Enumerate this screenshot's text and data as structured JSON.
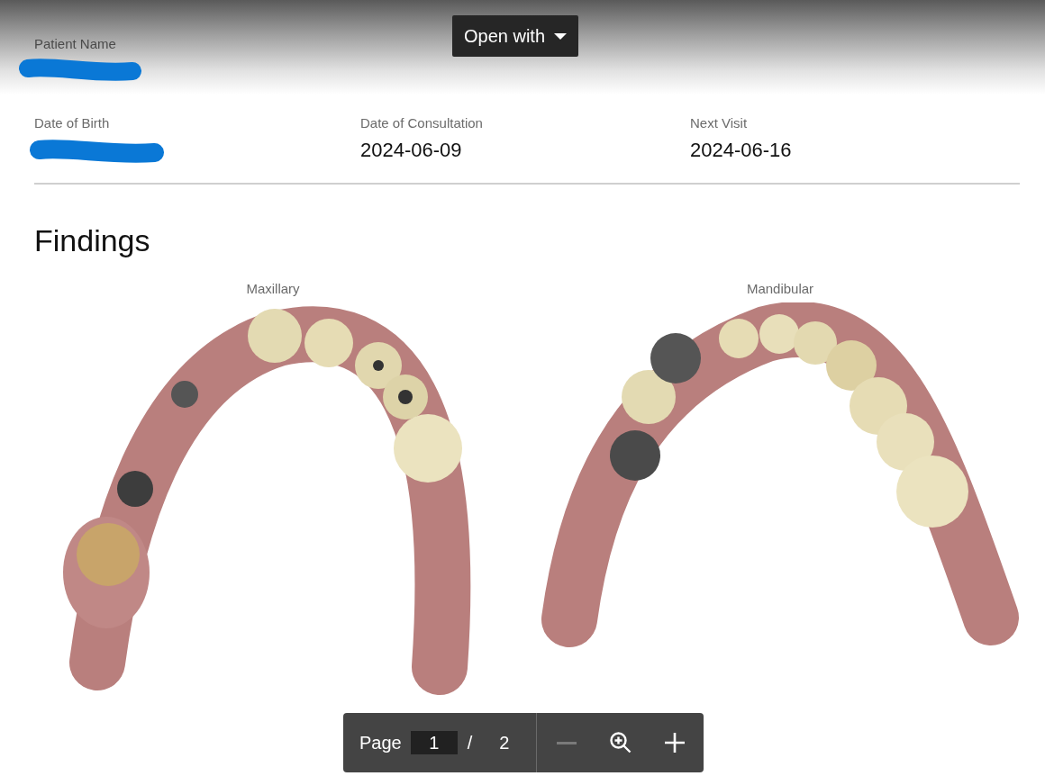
{
  "viewer": {
    "open_with": {
      "label": "Open with"
    }
  },
  "patient": {
    "name": {
      "label": "Patient Name",
      "redacted": true
    }
  },
  "details": [
    {
      "label": "Date of Birth",
      "redacted": true
    },
    {
      "label": "Date of Consultation",
      "value": "2024-06-09",
      "redacted": false
    },
    {
      "label": "Next Visit",
      "value": "2024-06-16",
      "redacted": false
    }
  ],
  "findings": {
    "title": "Findings",
    "scans": [
      {
        "kind": "maxillary",
        "label": "Maxillary"
      },
      {
        "kind": "mandibular",
        "label": "Mandibular"
      }
    ]
  },
  "toolbar": {
    "page_label": "Page",
    "current_page": "1",
    "separator": "/",
    "total_pages": "2",
    "buttons": [
      {
        "kind": "zoom_out",
        "disabled": true
      },
      {
        "kind": "zoom",
        "disabled": false
      },
      {
        "kind": "zoom_in",
        "disabled": false
      }
    ]
  }
}
